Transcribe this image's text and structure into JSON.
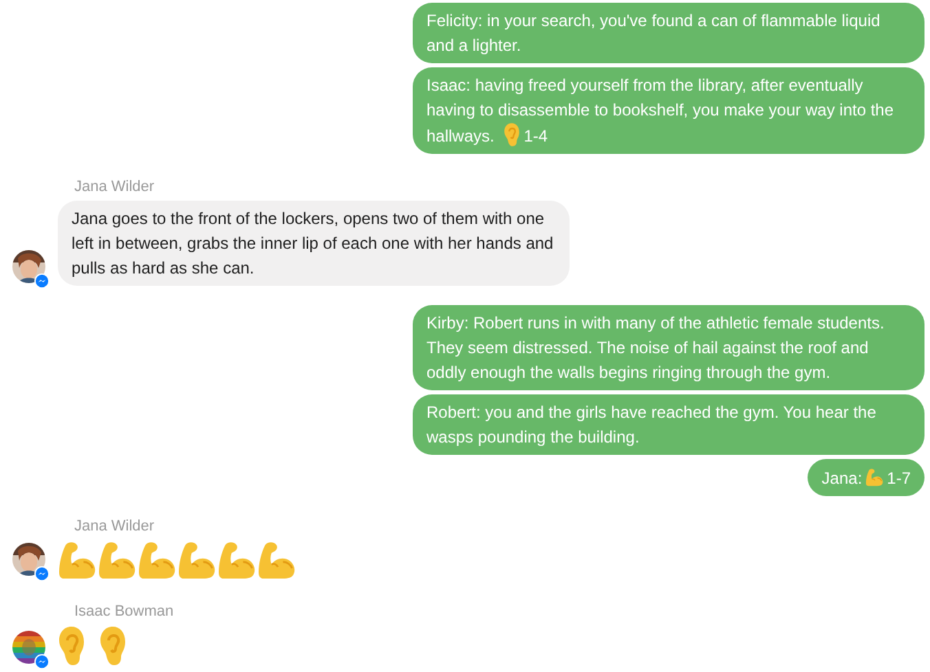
{
  "groups": [
    {
      "kind": "outgoing",
      "messages": [
        {
          "parts": [
            {
              "kind": "text",
              "text": "Felicity: in your search, you've found a can of flammable liquid and a lighter."
            }
          ]
        },
        {
          "parts": [
            {
              "kind": "text",
              "text": "Isaac: having freed yourself from the library, after eventually having to disassemble to bookshelf, you make your way into the hallways."
            },
            {
              "kind": "ear"
            },
            {
              "kind": "text",
              "text": "1-4"
            }
          ]
        }
      ]
    },
    {
      "kind": "incoming",
      "sender": "Jana Wilder",
      "messages": [
        {
          "parts": [
            {
              "kind": "text",
              "text": "Jana goes to the front of the lockers, opens two of them with one left in between, grabs the inner lip of each one with her hands and pulls as hard as she can."
            }
          ]
        }
      ]
    },
    {
      "kind": "outgoing",
      "messages": [
        {
          "parts": [
            {
              "kind": "text",
              "text": "Kirby: Robert runs in with many of the athletic female students. They seem distressed. The noise of hail against the roof and oddly enough the walls begins ringing through the gym."
            }
          ]
        },
        {
          "parts": [
            {
              "kind": "text",
              "text": "Robert: you and the girls have reached the gym. You hear the wasps pounding the building."
            }
          ]
        },
        {
          "parts": [
            {
              "kind": "text",
              "text": "Jana:"
            },
            {
              "kind": "biceps"
            },
            {
              "kind": "text",
              "text": "1-7"
            }
          ]
        }
      ]
    },
    {
      "kind": "incoming",
      "sender": "Jana Wilder",
      "messages": [
        {
          "parts": [
            {
              "kind": "biceps"
            },
            {
              "kind": "biceps"
            },
            {
              "kind": "biceps"
            },
            {
              "kind": "biceps"
            },
            {
              "kind": "biceps"
            },
            {
              "kind": "biceps"
            }
          ]
        }
      ]
    },
    {
      "kind": "incoming",
      "sender": "Isaac Bowman",
      "messages": [
        {
          "parts": [
            {
              "kind": "ear"
            },
            {
              "kind": "ear"
            }
          ]
        }
      ]
    }
  ]
}
